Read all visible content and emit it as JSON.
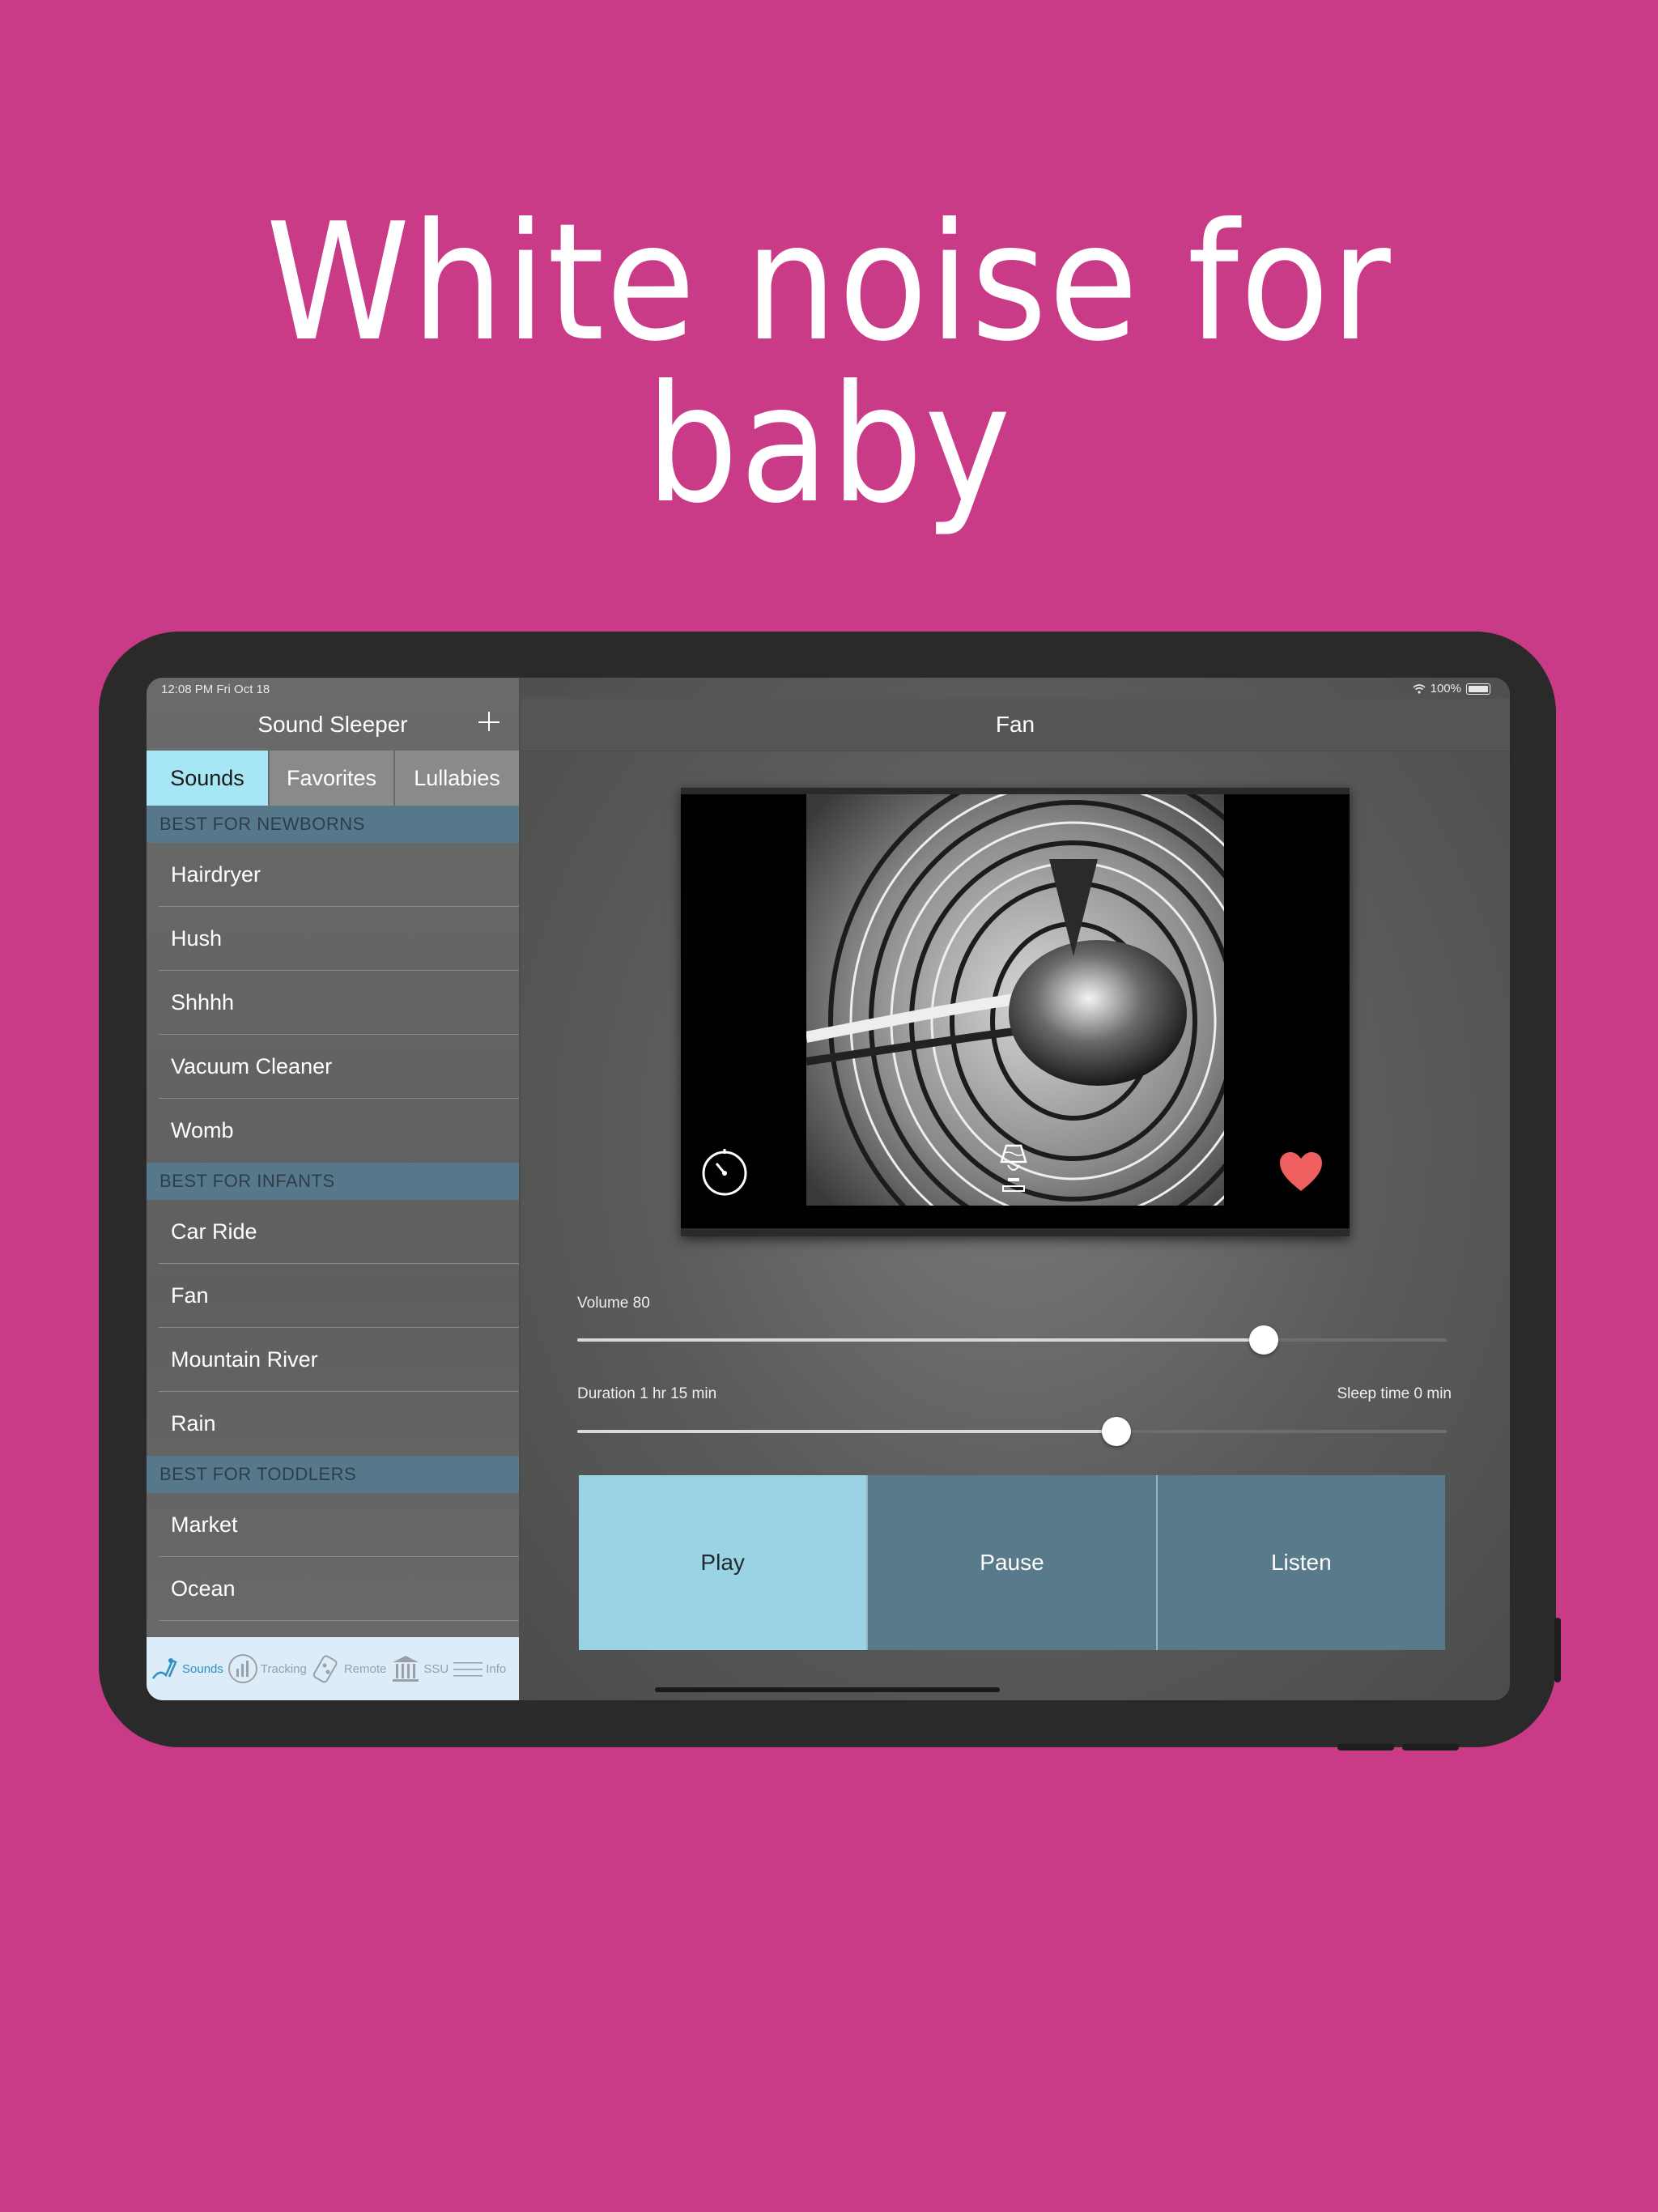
{
  "headline": "White noise for baby",
  "status": {
    "time": "12:08 PM   Fri Oct 18",
    "battery": "100%"
  },
  "sidebar": {
    "title": "Sound Sleeper",
    "segments": [
      "Sounds",
      "Favorites",
      "Lullabies"
    ],
    "sections": [
      {
        "header": "BEST FOR NEWBORNS",
        "items": [
          "Hairdryer",
          "Hush",
          "Shhhh",
          "Vacuum Cleaner",
          "Womb"
        ]
      },
      {
        "header": "BEST FOR INFANTS",
        "items": [
          "Car Ride",
          "Fan",
          "Mountain River",
          "Rain"
        ]
      },
      {
        "header": "BEST FOR TODDLERS",
        "items": [
          "Market",
          "Ocean"
        ]
      }
    ],
    "tabs": [
      {
        "label": "Sounds",
        "icon": "music-bird-icon",
        "active": true
      },
      {
        "label": "Tracking",
        "icon": "chart-icon"
      },
      {
        "label": "Remote",
        "icon": "remote-icon"
      },
      {
        "label": "SSU",
        "icon": "building-icon"
      },
      {
        "label": "Info",
        "icon": "menu-lines-icon"
      }
    ]
  },
  "detail": {
    "title": "Fan",
    "volume_label": "Volume 80",
    "volume_level": 0.79,
    "duration_label": "Duration 1 hr 15 min",
    "duration_level": 0.62,
    "sleep_label": "Sleep time 0 min",
    "buttons": [
      "Play",
      "Pause",
      "Listen"
    ]
  },
  "colors": {
    "background": "#c93a87",
    "accent": "#a6e6f5",
    "section": "#56788a",
    "heart": "#ef5f5f"
  }
}
